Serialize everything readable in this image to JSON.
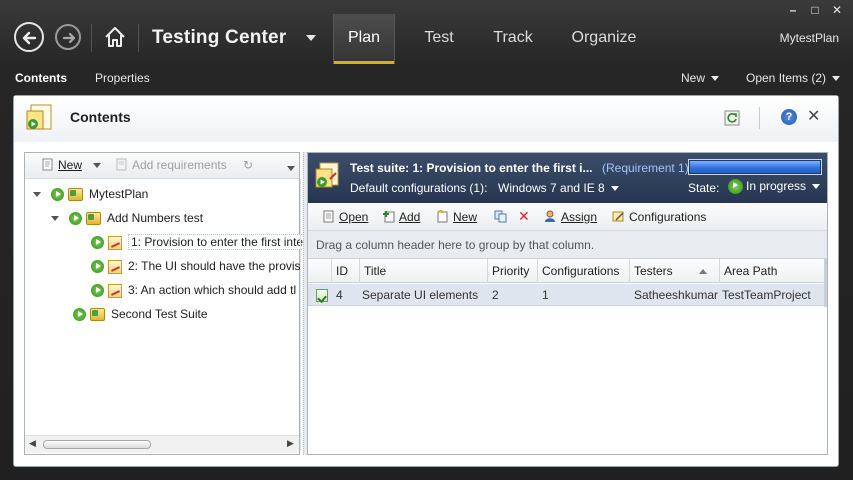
{
  "window": {
    "minimize": "–",
    "maximize": "□",
    "close": "✕"
  },
  "nav": {
    "app_title": "Testing Center",
    "tabs": [
      {
        "label": "Plan",
        "active": true
      },
      {
        "label": "Test",
        "active": false
      },
      {
        "label": "Track",
        "active": false
      },
      {
        "label": "Organize",
        "active": false
      }
    ],
    "user": "MytestPlan"
  },
  "subbar": {
    "contents": "Contents",
    "properties": "Properties",
    "new": "New",
    "open_items": "Open Items (2)"
  },
  "panel": {
    "title": "Contents",
    "help": "?",
    "close": "✕"
  },
  "tree": {
    "toolbar": {
      "new": "New",
      "add_requirements": "Add requirements"
    },
    "items": [
      {
        "label": "MytestPlan"
      },
      {
        "label": "Add Numbers test"
      },
      {
        "label": "1: Provision to enter the first inte"
      },
      {
        "label": "2: The UI should have the provis"
      },
      {
        "label": "3: An action which should add tl"
      },
      {
        "label": "Second Test Suite"
      }
    ]
  },
  "suite": {
    "title": "Test suite:  1: Provision to enter the first i...",
    "requirement": "(Requirement 1)",
    "progress": 1.0,
    "config_label": "Default configurations (1):",
    "config_value": "Windows 7 and IE 8",
    "state_label": "State:",
    "state_value": "In progress"
  },
  "toolbar": {
    "open": "Open",
    "add": "Add",
    "new": "New",
    "assign": "Assign",
    "configurations": "Configurations"
  },
  "group_hint": "Drag a column header here to group by that column.",
  "grid": {
    "columns": [
      "ID",
      "Title",
      "Priority",
      "Configurations",
      "Testers",
      "Area Path"
    ],
    "rows": [
      {
        "id": "4",
        "title": "Separate UI elements",
        "priority": "2",
        "configurations": "1",
        "testers": "Satheeshkumar",
        "area_path": "TestTeamProject"
      }
    ]
  },
  "colors": {
    "accent": "#e8a817",
    "suite_header": "#2c3d5c",
    "selection": "#dfe5ee"
  }
}
